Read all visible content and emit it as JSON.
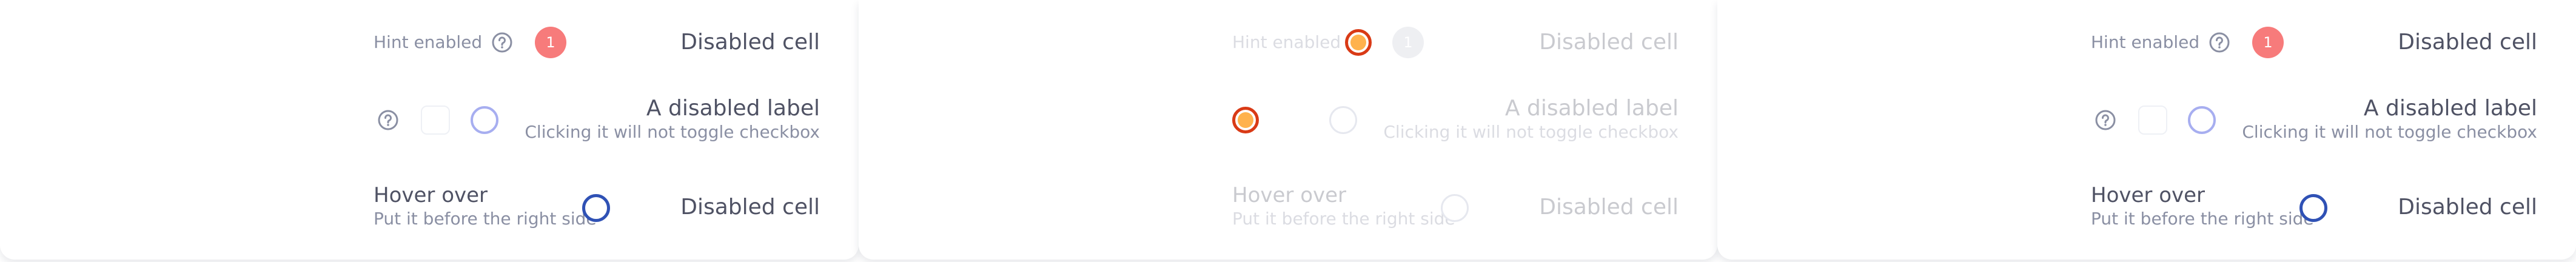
{
  "panels": [
    {
      "row1": {
        "hint": "Hint enabled",
        "badge": "1",
        "cell": "Disabled cell"
      },
      "row2": {
        "label": "A disabled label",
        "sublabel": "Clicking it will not toggle checkbox"
      },
      "row3": {
        "title": "Hover over",
        "subtitle": "Put it before the right side",
        "cell": "Disabled cell"
      }
    },
    {
      "row1": {
        "hint": "Hint enabled",
        "badge": "1",
        "cell": "Disabled cell"
      },
      "row2": {
        "label": "A disabled label",
        "sublabel": "Clicking it will not toggle checkbox"
      },
      "row3": {
        "title": "Hover over",
        "subtitle": "Put it before the right side",
        "cell": "Disabled cell"
      }
    },
    {
      "row1": {
        "hint": "Hint enabled",
        "badge": "1",
        "cell": "Disabled cell"
      },
      "row2": {
        "label": "A disabled label",
        "sublabel": "Clicking it will not toggle checkbox"
      },
      "row3": {
        "title": "Hover over",
        "subtitle": "Put it before the right side",
        "cell": "Disabled cell"
      }
    }
  ],
  "icons": {
    "help": "question-circle-icon",
    "focus": "focus-ring-indicator"
  },
  "colors": {
    "badge": "#f77b7b",
    "radio_outline_light": "#a7aef0",
    "radio_outline_dark": "#2f51b5",
    "focus_ring_outer": "#d93a16",
    "focus_ring_inner": "#ffb24d",
    "text_primary": "#4f5264",
    "text_secondary": "#8a8fa3"
  }
}
